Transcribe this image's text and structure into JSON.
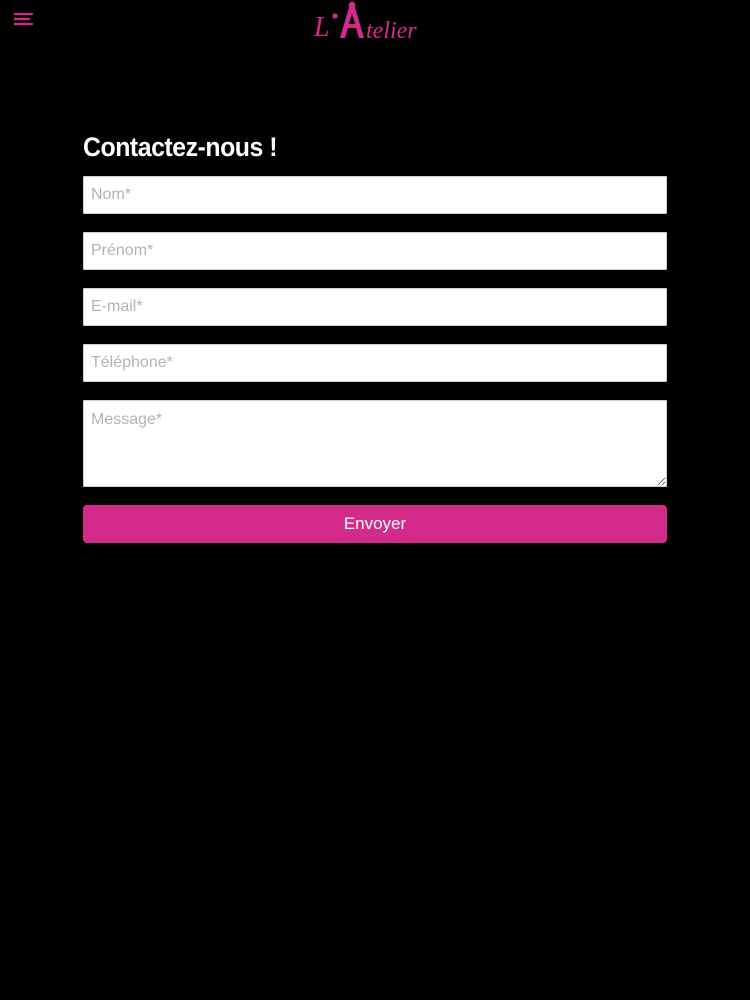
{
  "header": {
    "menu_icon": "hamburger-menu-icon",
    "logo_text": "L'Atelier",
    "accent_color": "#d42a8a"
  },
  "contact": {
    "title": "Contactez-nous !",
    "fields": {
      "nom": {
        "placeholder": "Nom*",
        "value": ""
      },
      "prenom": {
        "placeholder": "Prénom*",
        "value": ""
      },
      "email": {
        "placeholder": "E-mail*",
        "value": ""
      },
      "telephone": {
        "placeholder": "Téléphone*",
        "value": ""
      },
      "message": {
        "placeholder": "Message*",
        "value": ""
      }
    },
    "submit_label": "Envoyer"
  }
}
